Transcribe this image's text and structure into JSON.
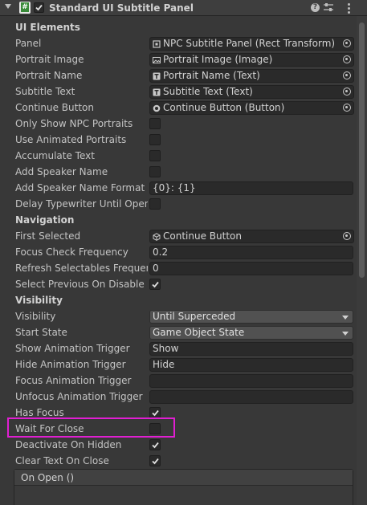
{
  "header": {
    "title": "Standard UI Subtitle Panel",
    "enabled": true,
    "script_icon_glyph": "#"
  },
  "sections": {
    "ui_elements": "UI Elements",
    "navigation": "Navigation",
    "visibility": "Visibility"
  },
  "fields": {
    "panel": {
      "label": "Panel",
      "value": "NPC Subtitle Panel (Rect Transform)",
      "icon": "rect-transform-icon"
    },
    "portrait_image": {
      "label": "Portrait Image",
      "value": "Portrait Image (Image)",
      "icon": "image-icon"
    },
    "portrait_name": {
      "label": "Portrait Name",
      "value": "Portrait Name (Text)",
      "icon": "text-icon"
    },
    "subtitle_text": {
      "label": "Subtitle Text",
      "value": "Subtitle Text (Text)",
      "icon": "text-icon"
    },
    "continue_button": {
      "label": "Continue Button",
      "value": "Continue Button (Button)",
      "icon": "button-icon"
    },
    "only_show_npc_portraits": {
      "label": "Only Show NPC Portraits",
      "checked": false
    },
    "use_animated_portraits": {
      "label": "Use Animated Portraits",
      "checked": false
    },
    "accumulate_text": {
      "label": "Accumulate Text",
      "checked": false
    },
    "add_speaker_name": {
      "label": "Add Speaker Name",
      "checked": false
    },
    "add_speaker_name_format": {
      "label": "Add Speaker Name Format",
      "value": "{0}: {1}"
    },
    "delay_typewriter_until_open": {
      "label": "Delay Typewriter Until Open",
      "checked": false
    },
    "first_selected": {
      "label": "First Selected",
      "value": "Continue Button",
      "icon": "gameobject-icon"
    },
    "focus_check_frequency": {
      "label": "Focus Check Frequency",
      "value": "0.2"
    },
    "refresh_selectables_frequency": {
      "label": "Refresh Selectables Frequency",
      "value": "0"
    },
    "select_previous_on_disable": {
      "label": "Select Previous On Disable",
      "checked": true
    },
    "visibility": {
      "label": "Visibility",
      "value": "Until Superceded"
    },
    "start_state": {
      "label": "Start State",
      "value": "Game Object State"
    },
    "show_animation_trigger": {
      "label": "Show Animation Trigger",
      "value": "Show"
    },
    "hide_animation_trigger": {
      "label": "Hide Animation Trigger",
      "value": "Hide"
    },
    "focus_animation_trigger": {
      "label": "Focus Animation Trigger",
      "value": ""
    },
    "unfocus_animation_trigger": {
      "label": "Unfocus Animation Trigger",
      "value": ""
    },
    "has_focus": {
      "label": "Has Focus",
      "checked": true
    },
    "wait_for_close": {
      "label": "Wait For Close",
      "checked": false
    },
    "deactivate_on_hidden": {
      "label": "Deactivate On Hidden",
      "checked": true
    },
    "clear_text_on_close": {
      "label": "Clear Text On Close",
      "checked": true
    }
  },
  "events": {
    "on_open": "On Open ()"
  },
  "colors": {
    "background": "#383838",
    "highlight": "#e01fd2",
    "field_bg": "#2a2a2a"
  }
}
